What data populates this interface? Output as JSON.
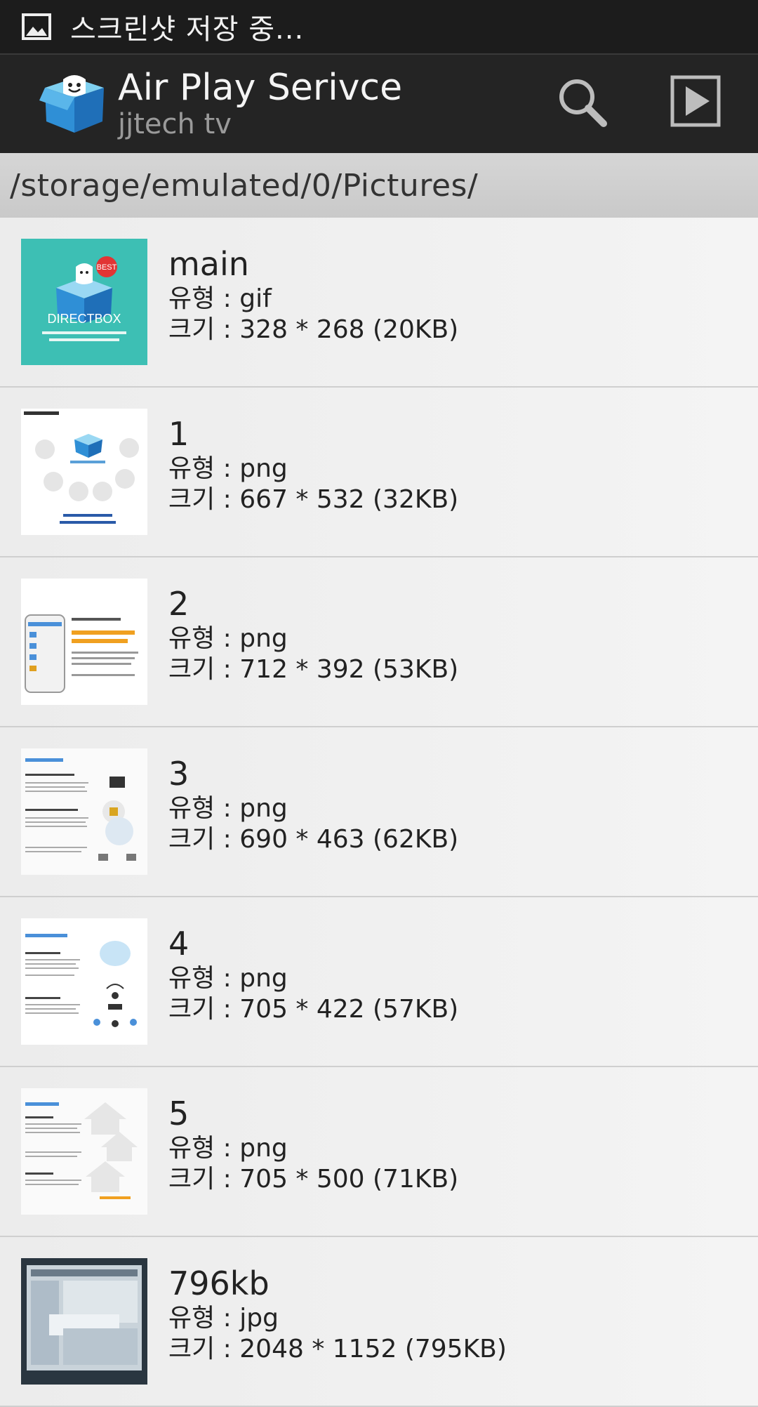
{
  "status_bar": {
    "notification_text": "스크린샷 저장 중..."
  },
  "action_bar": {
    "title": "Air Play Serivce",
    "subtitle": "jjtech tv",
    "icons": [
      "search-icon",
      "play-icon"
    ]
  },
  "path": "/storage/emulated/0/Pictures/",
  "files": [
    {
      "name": "main",
      "type": "유형 : gif",
      "size": "크기 : 328 * 268 (20KB)"
    },
    {
      "name": "1",
      "type": "유형 : png",
      "size": "크기 : 667 * 532 (32KB)"
    },
    {
      "name": "2",
      "type": "유형 : png",
      "size": "크기 : 712 * 392 (53KB)"
    },
    {
      "name": "3",
      "type": "유형 : png",
      "size": "크기 : 690 * 463 (62KB)"
    },
    {
      "name": "4",
      "type": "유형 : png",
      "size": "크기 : 705 * 422 (57KB)"
    },
    {
      "name": "5",
      "type": "유형 : png",
      "size": "크기 : 705 * 500 (71KB)"
    },
    {
      "name": "796kb",
      "type": "유형 : jpg",
      "size": "크기 : 2048 * 1152 (795KB)"
    }
  ],
  "thumbnails": {
    "main_label": "DIRECTBOX",
    "main_badge": "BEST"
  },
  "colors": {
    "status_bar": "#1c1c1c",
    "action_bar": "#242424",
    "path_bar": "#cfcfcf",
    "list_bg": "#efefef",
    "thumb_teal": "#3dbfb4"
  }
}
